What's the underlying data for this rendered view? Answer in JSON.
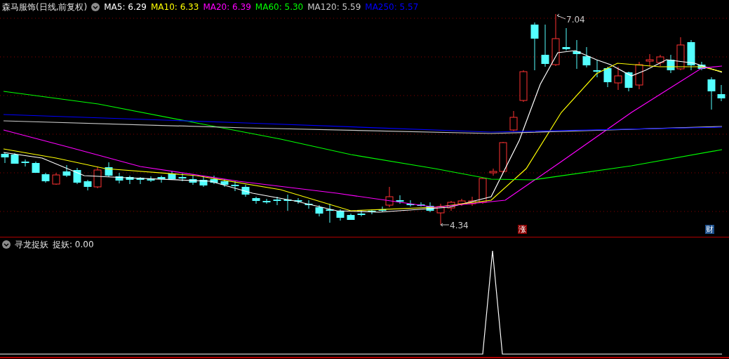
{
  "main_chart": {
    "title": "森马服饰(日线,前复权)",
    "ma_legend": [
      {
        "label": "MA5: 6.29",
        "color": "#ffffff"
      },
      {
        "label": "MA10: 6.33",
        "color": "#ffff00"
      },
      {
        "label": "MA20: 6.39",
        "color": "#ff00ff"
      },
      {
        "label": "MA60: 5.30",
        "color": "#00ff00"
      },
      {
        "label": "MA120: 5.59",
        "color": "#c8c8c8"
      },
      {
        "label": "MA250: 5.57",
        "color": "#0000ff"
      }
    ],
    "high_label": "7.04",
    "low_label": "4.34",
    "markers": [
      {
        "text": "涨",
        "kind": "limit"
      },
      {
        "text": "财",
        "kind": "finance"
      }
    ]
  },
  "indicator": {
    "title": "寻龙捉妖",
    "reading": "捉妖: 0.00"
  }
}
